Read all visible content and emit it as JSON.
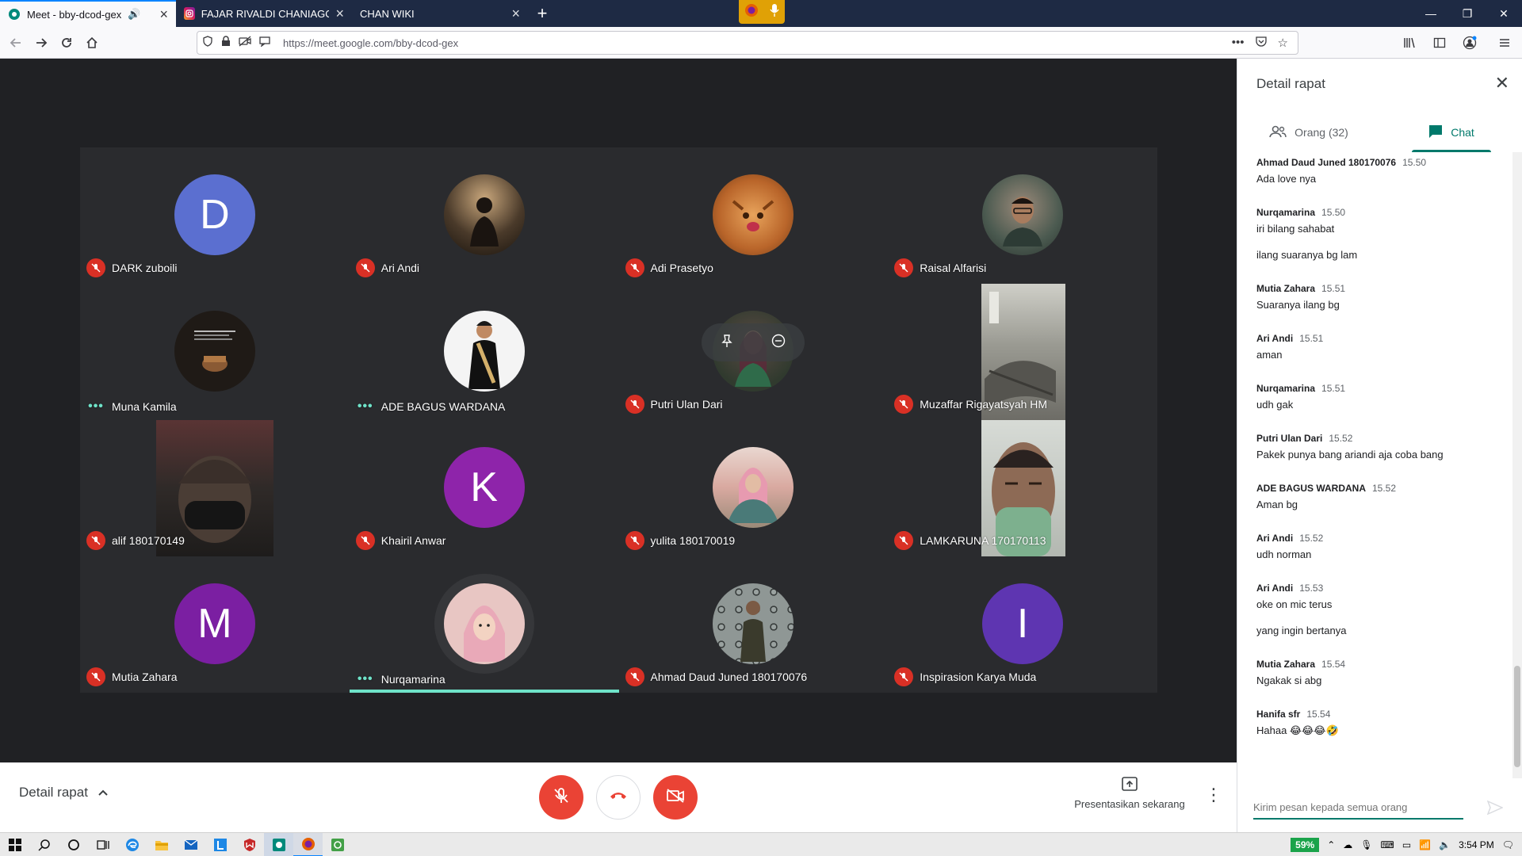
{
  "browser": {
    "tabs": [
      {
        "title": "Meet - bby-dcod-gex",
        "active": true,
        "favicon": "google-meet-icon"
      },
      {
        "title": "FAJAR RIVALDI CHANIAGO (@",
        "active": false,
        "favicon": "instagram-icon"
      },
      {
        "title": "CHAN WIKI",
        "active": false,
        "favicon": ""
      }
    ],
    "url": "https://meet.google.com/bby-dcod-gex"
  },
  "participants": [
    {
      "name": "DARK zuboili",
      "initial": "D",
      "avatar_color": "#5b6fd0",
      "muted": true
    },
    {
      "name": "Ari Andi",
      "initial": "",
      "avatar_color": "#5a4a3a",
      "muted": true
    },
    {
      "name": "Adi Prasetyo",
      "initial": "",
      "avatar_color": "#c9782f",
      "muted": true
    },
    {
      "name": "Raisal Alfarisi",
      "initial": "",
      "avatar_color": "#5a6b5a",
      "muted": true
    },
    {
      "name": "Muna Kamila",
      "initial": "",
      "avatar_color": "#2b2520",
      "muted": false
    },
    {
      "name": "ADE BAGUS WARDANA",
      "initial": "",
      "avatar_color": "#f2f2f2",
      "muted": false
    },
    {
      "name": "Putri Ulan Dari",
      "initial": "",
      "avatar_color": "#3c4a3a",
      "muted": true
    },
    {
      "name": "Muzaffar Rigayatsyah HM",
      "initial": "",
      "avatar_color": "#8a8a84",
      "muted": true
    },
    {
      "name": "alif 180170149",
      "initial": "",
      "avatar_color": "#2f2a2a",
      "muted": true
    },
    {
      "name": "Khairil Anwar",
      "initial": "K",
      "avatar_color": "#8e24aa",
      "muted": true
    },
    {
      "name": "yulita 180170019",
      "initial": "",
      "avatar_color": "#d9a9a0",
      "muted": true
    },
    {
      "name": "LAMKARUNA 170170113",
      "initial": "",
      "avatar_color": "#9aa29a",
      "muted": true
    },
    {
      "name": "Mutia Zahara",
      "initial": "M",
      "avatar_color": "#7b1fa2",
      "muted": true
    },
    {
      "name": "Nurqamarina",
      "initial": "",
      "avatar_color": "#e8c6c3",
      "muted": false
    },
    {
      "name": "Ahmad Daud Juned 180170076",
      "initial": "",
      "avatar_color": "#6b6f6c",
      "muted": true
    },
    {
      "name": "Inspirasion Karya Muda",
      "initial": "I",
      "avatar_color": "#5e35b1",
      "muted": true
    }
  ],
  "controls": {
    "details_label": "Detail rapat",
    "present_label": "Presentasikan sekarang"
  },
  "panel": {
    "title": "Detail rapat",
    "people_tab": "Orang (32)",
    "chat_tab": "Chat",
    "input_placeholder": "Kirim pesan kepada semua orang",
    "messages": [
      {
        "sender": "Ahmad Daud Juned 180170076",
        "time": "15.50",
        "lines": [
          "Ada love nya"
        ]
      },
      {
        "sender": "Nurqamarina",
        "time": "15.50",
        "lines": [
          "iri bilang sahabat",
          "ilang suaranya bg lam"
        ]
      },
      {
        "sender": "Mutia Zahara",
        "time": "15.51",
        "lines": [
          "Suaranya ilang bg"
        ]
      },
      {
        "sender": "Ari Andi",
        "time": "15.51",
        "lines": [
          "aman"
        ]
      },
      {
        "sender": "Nurqamarina",
        "time": "15.51",
        "lines": [
          "udh gak"
        ]
      },
      {
        "sender": "Putri Ulan Dari",
        "time": "15.52",
        "lines": [
          "Pakek punya bang ariandi aja coba bang"
        ]
      },
      {
        "sender": "ADE BAGUS WARDANA",
        "time": "15.52",
        "lines": [
          "Aman bg"
        ]
      },
      {
        "sender": "Ari Andi",
        "time": "15.52",
        "lines": [
          "udh norman"
        ]
      },
      {
        "sender": "Ari Andi",
        "time": "15.53",
        "lines": [
          "oke on mic terus",
          "yang ingin bertanya"
        ]
      },
      {
        "sender": "Mutia Zahara",
        "time": "15.54",
        "lines": [
          "Ngakak si abg"
        ]
      },
      {
        "sender": "Hanifa sfr",
        "time": "15.54",
        "lines": [
          "Hahaa 😂😂😂🤣"
        ]
      }
    ]
  },
  "taskbar": {
    "battery": "59%",
    "clock": "3:54 PM"
  },
  "colors": {
    "meet_green": "#00796b",
    "mute_red": "#d93025",
    "speaking_teal": "#6fe3c9",
    "stage_bg": "#202124"
  }
}
